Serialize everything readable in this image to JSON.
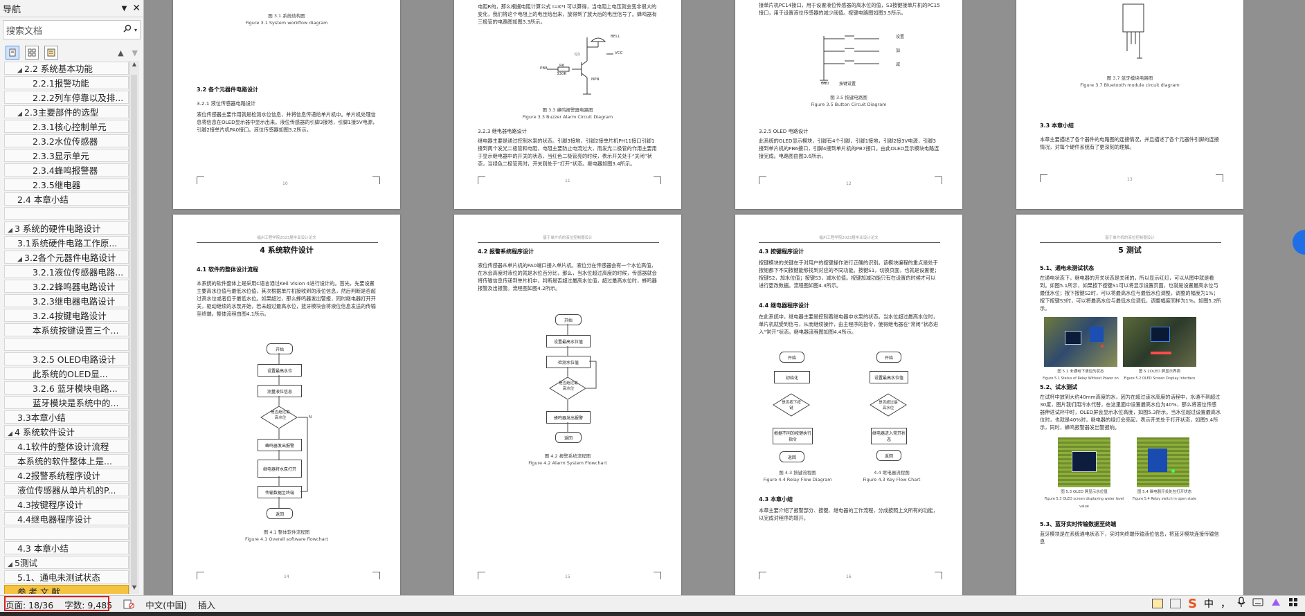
{
  "nav": {
    "title": "导航",
    "search_placeholder": "搜索文档",
    "items": [
      {
        "level": 2,
        "text": "2.2 系统基本功能",
        "expand": "◢"
      },
      {
        "level": 3,
        "text": "2.2.1报警功能"
      },
      {
        "level": 3,
        "text": "2.2.2列车停靠以及排..."
      },
      {
        "level": 2,
        "text": "2.3主要部件的选型",
        "expand": "◢"
      },
      {
        "level": 3,
        "text": "2.3.1核心控制单元"
      },
      {
        "level": 3,
        "text": "2.3.2水位传感器"
      },
      {
        "level": 3,
        "text": "2.3.3显示单元"
      },
      {
        "level": 3,
        "text": "2.3.4蜂鸣报警器"
      },
      {
        "level": 3,
        "text": "2.3.5继电器"
      },
      {
        "level": 2,
        "text": "2.4 本章小结"
      },
      {
        "level": 0,
        "text": ""
      },
      {
        "level": 1,
        "text": "3 系统的硬件电路设计",
        "expand": "◢"
      },
      {
        "level": 2,
        "text": "3.1系统硬件电路工作原..."
      },
      {
        "level": 2,
        "text": "3.2各个元器件电路设计",
        "expand": "◢"
      },
      {
        "level": 3,
        "text": "3.2.1液位传感器电路..."
      },
      {
        "level": 3,
        "text": "3.2.2蜂鸣器电路设计"
      },
      {
        "level": 3,
        "text": "3.2.3继电器电路设计"
      },
      {
        "level": 3,
        "text": "3.2.4按键电路设计"
      },
      {
        "level": 3,
        "text": "本系统按键设置三个..."
      },
      {
        "level": 0,
        "text": ""
      },
      {
        "level": 3,
        "text": "3.2.5 OLED电路设计"
      },
      {
        "level": 3,
        "text": "此系统的OLED显..."
      },
      {
        "level": 3,
        "text": "3.2.6 蓝牙模块电路..."
      },
      {
        "level": 3,
        "text": "蓝牙模块是系统中的..."
      },
      {
        "level": 2,
        "text": "3.3本章小结"
      },
      {
        "level": 1,
        "text": "4 系统软件设计",
        "expand": "◢"
      },
      {
        "level": 2,
        "text": "4.1软件的整体设计流程"
      },
      {
        "level": 2,
        "text": "本系统的软件整体上是..."
      },
      {
        "level": 2,
        "text": "4.2报警系统程序设计"
      },
      {
        "level": 2,
        "text": "液位传感器从单片机的P..."
      },
      {
        "level": 2,
        "text": "4.3按键程序设计"
      },
      {
        "level": 2,
        "text": "4.4继电器程序设计"
      },
      {
        "level": 0,
        "text": ""
      },
      {
        "level": 2,
        "text": "4.3 本章小结"
      },
      {
        "level": 1,
        "text": "5测试",
        "expand": "◢"
      },
      {
        "level": 2,
        "text": "5.1、通电未测试状态"
      },
      {
        "level": 2,
        "text": "参 考 文 献",
        "active": true
      }
    ]
  },
  "pages": {
    "p1": {
      "fig_cn": "图 3.1 系统结构图",
      "fig_en": "Figure 3.1 System workflow diagram",
      "h1": "3.2 各个元器件电路设计",
      "h2": "3.2.1 液位传感器电路设计",
      "body": "液位传感器主要作用就是检测水位信息，并将信息传递给单片机中。单片机处理信息将信息在OLED显示器中显示出来。液位传感器的引脚3接地，引脚1接5V电源，引脚2接单片机PA0接口。液位传感器如图3.2所示。",
      "num": "10"
    },
    "p2": {
      "top": "电阻R的，那么根据电阻计算公式 I=K*I 可以算得，当电阻上电压就会变非很大的变化，我们将这个电阻上的电压给出来，放得到了放大后的电压信号了。蜂鸣器有三极管的电路图如图3.3所示。",
      "fig_cn": "图 3.3 蜂鸣报警器电路图",
      "fig_en": "Figure 3.3 Buzzer Alarm Circuit Diagram",
      "h": "3.2.3 继电器电路设计",
      "body": "继电器主要是通过控制水泵的状态。引脚3接地，引脚2接单片机PH11接口引脚1接到两个发光二极管和电阻，电阻主要防止电流过大，而发光二极管的作用主要用于显示继电器中的开关的状态，当红色二极管亮的时候，表示开关处于“关闭”状态，当绿色二极管亮时，开关则处于“打开”状态。继电器如图3.4所示。",
      "num": "11",
      "labels": {
        "bell": "BELL",
        "vcc": "VCC",
        "q1": "Q1",
        "r": "R6",
        "res": "330R",
        "pb": "PB8",
        "npn": "NPN"
      }
    },
    "p3": {
      "top": "接单片机PC14接口，用于设置液位传感器的高水位的值，S3按键接单片机的PC15接口，用于设置液位传感器的减少阈值。按键电路图如图3.5所示。",
      "labels": {
        "set": "设置",
        "add": "加",
        "sub": "减",
        "key": "按键设置",
        "gnd": "GND"
      },
      "fig_cn": "图 3.5 按键电路图",
      "fig_en": "Figure 3.5 Button Circuit Diagram",
      "h": "3.2.5 OLED 电路设计",
      "body": "此系统的OLED显示模块，引脚有4个引脚，引脚1接地，引脚2接3V电源，引脚3接到单片机的PB6接口，引脚4接到单片机的PB7接口。由此OLED显示模块电路连接完成。电路图由图3.6所示。",
      "num": "12"
    },
    "p4": {
      "fig_cn": "图 3.7 蓝牙模块电路图",
      "fig_en": "Figure 3.7 Bluetooth module circuit diagram",
      "h": "3.3 本章小结",
      "body": "本章主要描述了各个器件的电路图的连接情况，并且描述了各个元器件引脚的连接情况，对每个硬件系统有了更深刻的理解。",
      "num": "13"
    },
    "p5": {
      "header": "福州工程学院2023届毕业设计论文",
      "title": "4 系统软件设计",
      "h": "4.1 软件的整体设计流程",
      "body": "本系统的软件整体上是采用C语言通过Keil Vision 4进行设计的。首先，先要设置主要高水位值与最低水位值，其次根据单片机接收到的液位信息，然后判断是否超过高水位或者低于最低水位。如果超过，那么蜂鸣器发出警报，同时继电器打开开关，驱动继续的水泵开始，若未超过最高水位，蓝牙模块会将液位信息发送的传输至终端。整体流程由图4.1所示。",
      "fc": {
        "start": "开始",
        "set": "设置最高水位",
        "read": "测量液位信息",
        "q": "是否超过最高水位",
        "alarm": "蜂鸣器发出报警",
        "relay": "继电器将水泵打开",
        "send": "传输数据至终端",
        "end": "返回",
        "no": "N"
      },
      "fig_cn": "图 4.1 整体软件流程图",
      "fig_en": "Figure 4.1 Overall software flowchart",
      "num": "14"
    },
    "p6": {
      "header": "基于单片机的液位控制器设计",
      "h": "4.2 报警系统程序设计",
      "body": "液位传感器从单片机的PA0端口接入单片机，液位分在传感器会有一个水位高值，在水会高度时液位的就是水位百分比，那么，当水位超过高度的时候，传感器就会将传输信息传递到单片机中，判断是否超过最高水位值，超过最高水位时，蜂鸣器报警及出报警。流程图如图4.2所示。",
      "fc": {
        "start": "开始",
        "set": "设置最高水位值",
        "read": "检测水位值",
        "q": "是否超过最高水位",
        "alarm": "蜂鸣器发出报警",
        "end": "返回"
      },
      "fig_cn": "图 4.2 报警系统流程图",
      "fig_en": "Figure 4.2 Alarm System Flowchart",
      "num": "15"
    },
    "p7": {
      "header": "福州工程学院2023届毕业设计论文",
      "h1": "4.3 按键程序设计",
      "body1": "按键模块的关键在于对用户的按键操作进行正确的识别。该模块编程的重点是处于按钮都下不同按键能够找到对应的不同功能。按键S1，切换页面，也就是设置键；按键S2，加水位值；按键S3，减水位值。按键加减功能只有在设置的时候才可以进行更改数据。流程图如图4.3所示。",
      "h2": "4.4 继电器程序设计",
      "body2": "在此系统中，继电器主要是控制着继电器中水泵的状态。当水位超过最高水位时，单片机就受到信号，从而继续操作，由主程序的指令，使得继电器在“常闭”状态进入“常开”状态。继电器流程图如图4.4所示。",
      "fcA": {
        "start": "开始",
        "init": "初始化",
        "q": "是否按下按键",
        "exec": "根据不同的按键执行指令",
        "end": "返回"
      },
      "fcB": {
        "start": "开始",
        "set": "设置最高水位值",
        "q": "是否超过最高水位",
        "relay": "继电器进入常开状态",
        "end": "返回"
      },
      "figA_cn": "图 4.3 按键流程图",
      "figA_en": "Figure 4.4 Relay Flow Diagram",
      "figB_cn": "4.4 继电器流程图",
      "figB_en": "Figure 4.3 Key Flow Chart",
      "h3": "4.3 本章小结",
      "body3": "本章主要介绍了报警部分、按键、继电器的工作流程，分成按照上文所有的功能，以完成对程序的增开。",
      "num": "16"
    },
    "p8": {
      "header": "基于单片机的液位控制器设计",
      "title": "5 测试",
      "h1": "5.1、通电未测试状态",
      "body1": "在通电状态下，继电器的开关状态是关闭的，所以显示红灯，可以从图中就是看到。如图5.1所示，如果按下按键S1可以将显示设置页面，也就是设置最高水位与最低水位；按下按键S2时，可以将最高水位与最低水位调整，调整的幅度为1%；按下按键S3时，可以将最高水位与最低水位调低，调整幅度同样为1%。如图5.2所示。",
      "cap1_cn": "图 5.1 未通电下液位的状态",
      "cap1_en": "Figure 5.1 Status of Relay Without Power on",
      "cap2_cn": "图 5.2OLED 屏显示界面",
      "cap2_en": "Figure 5.2 OLED Screen Display Interface",
      "h2": "5.2、试水测试",
      "body2": "在试杯中放到大约40mm高度的水，因为在超过该水高度的话程中，水通不到超过30度，图片我们用冷水代替，在这里面中设置最高水位为40%，那么将液位传感器伸进试杯中时，OLED屏会显示水位高度，如图5.3所示。当水位超过设置最高水位时，也就是40%时，继电器的绿灯会亮起，表示开关处于打开状态，如图5.4所示，同时，蜂鸣报警器发出警报响。",
      "cap3_cn": "图 5.3 OLED 屏显示水位值",
      "cap3_en": "Figure 5.3 OLED screen displaying water level value",
      "cap4_cn": "图 5.4 继电器开关处在打开状态",
      "cap4_en": "Figure 5.4 Relay switch in open state",
      "h3": "5.3、蓝牙实时传输数据至终端",
      "body3": "蓝牙模块是在系统通电状态下，实时向终端传输液位信息，将蓝牙模块连接传输信息"
    }
  },
  "status": {
    "page": "页面: 18/36",
    "words": "字数: 9,485",
    "lang": "中文(中国)",
    "mode": "插入"
  },
  "ime": {
    "logo": "S",
    "cn": "中",
    "punct": "，"
  },
  "colors": {
    "accent_red": "#d62020",
    "nav_active": "#f5c342",
    "ime_logo": "#e8541c"
  }
}
